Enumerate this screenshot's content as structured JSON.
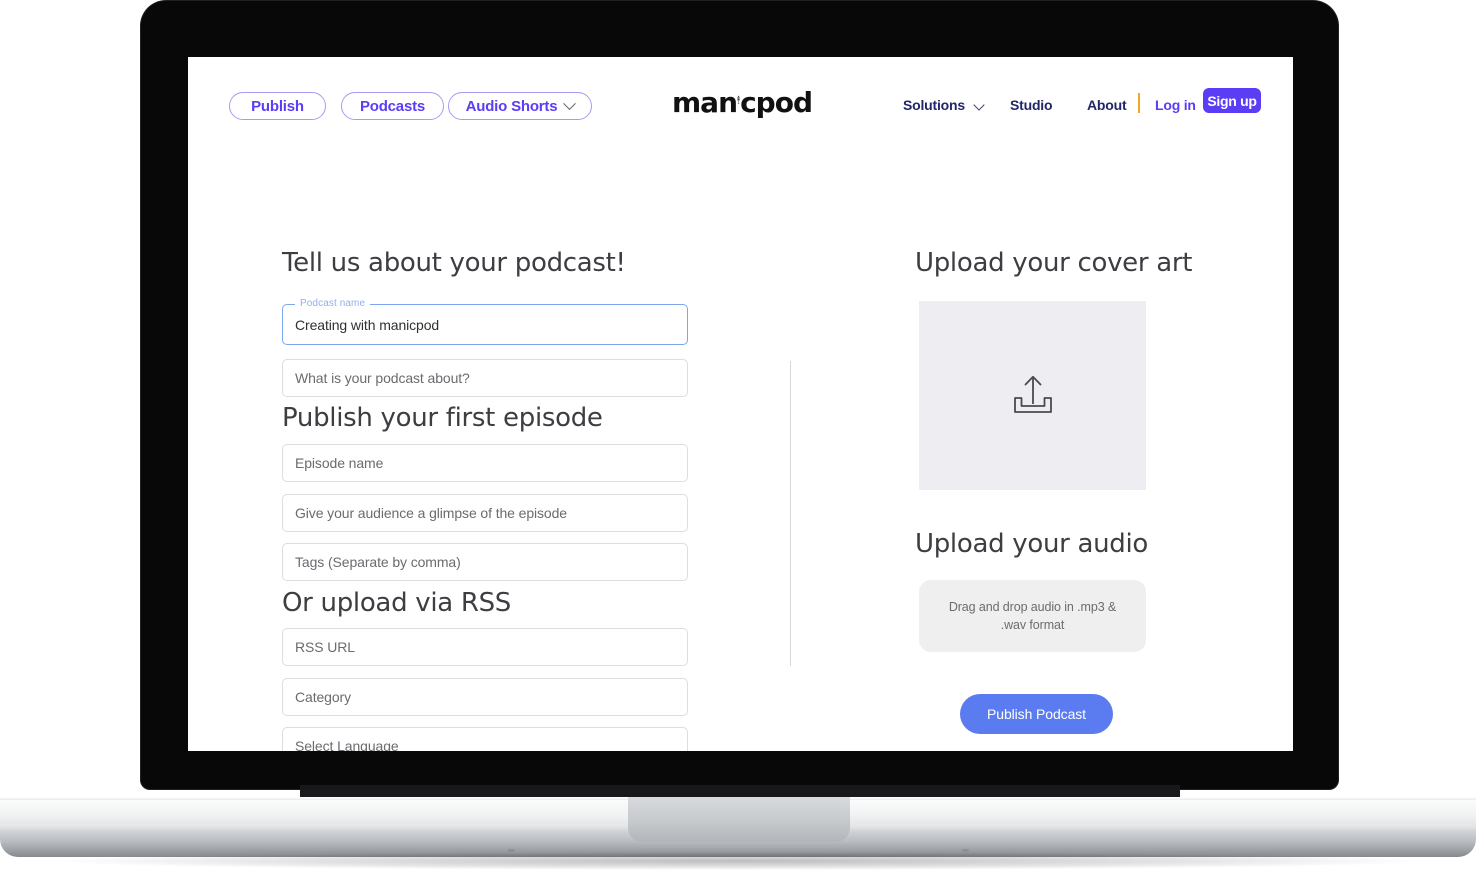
{
  "header": {
    "pills": [
      {
        "label": "Publish",
        "name": "nav-pill-publish"
      },
      {
        "label": "Podcasts",
        "name": "nav-pill-podcasts"
      },
      {
        "label": "Audio Shorts",
        "name": "nav-pill-audio-shorts"
      }
    ],
    "brand": {
      "name": "manicpod",
      "wordmark_left": "man",
      "wordmark_right": "cpod",
      "icon": "microphone-icon"
    },
    "nav": {
      "solutions": "Solutions",
      "solutions_icon": "chevron-down-icon",
      "studio": "Studio",
      "about": "About",
      "login": "Log in",
      "signup": "Sign up"
    },
    "colors": {
      "brand_purple": "#5B3DF5",
      "nav_navy": "#21266b",
      "divider_orange": "#F5A623"
    }
  },
  "main": {
    "form": {
      "heading_podcast": "Tell us about your podcast!",
      "podcast_name_label": "Podcast name",
      "podcast_name_value": "Creating with manicpod",
      "podcast_about_placeholder": "What is your podcast about?",
      "heading_episode": "Publish your first episode",
      "episode_name_placeholder": "Episode name",
      "episode_desc_placeholder": "Give your audience a glimpse of the episode",
      "tags_placeholder": "Tags (Separate by comma)",
      "heading_rss": "Or upload via RSS",
      "rss_url_placeholder": "RSS URL",
      "category_placeholder": "Category",
      "language_placeholder": "Select Language"
    },
    "uploads": {
      "heading_cover_art": "Upload your cover art",
      "cover_art_icon": "upload-tray-icon",
      "heading_audio": "Upload your audio",
      "audio_dropzone_text": "Drag and drop audio in .mp3 & .wav format",
      "publish_button": "Publish Podcast",
      "colors": {
        "publish_button": "#5B7BF0",
        "cover_dropzone": "#EDEDF2",
        "audio_dropzone": "#EFEFEF"
      }
    }
  },
  "device": {
    "type": "laptop-mockup"
  }
}
